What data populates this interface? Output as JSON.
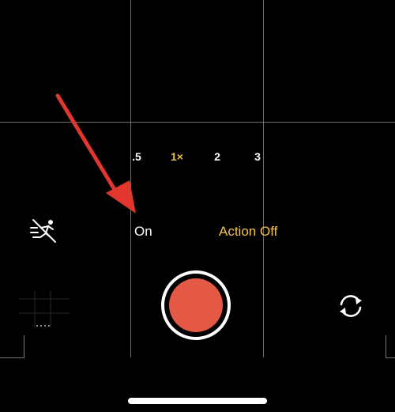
{
  "camera": {
    "zoom_levels": [
      ".5",
      "1×",
      "2",
      "3"
    ],
    "active_zoom": "1×",
    "stabilization_label": "On",
    "action_mode_label": "Action Off"
  },
  "icons": {
    "action_mode": "action-mode-off-icon",
    "flip_camera": "flip-camera-icon",
    "shutter": "record-button"
  },
  "colors": {
    "accent": "#f2c249",
    "record": "#e45846",
    "annotation_arrow": "#e1372f"
  }
}
